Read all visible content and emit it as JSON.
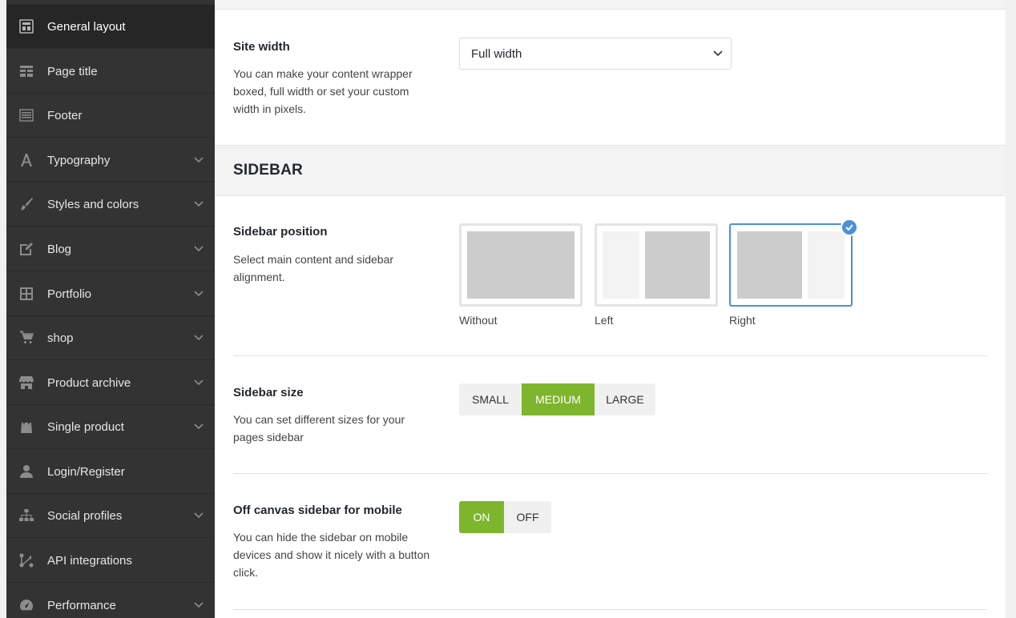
{
  "sidebar": {
    "items": [
      {
        "label": "General layout",
        "icon": "layout-icon",
        "has_chevron": false,
        "active": true
      },
      {
        "label": "Page title",
        "icon": "page-title-icon",
        "has_chevron": false,
        "active": false
      },
      {
        "label": "Footer",
        "icon": "footer-icon",
        "has_chevron": false,
        "active": false
      },
      {
        "label": "Typography",
        "icon": "typography-icon",
        "has_chevron": true,
        "active": false
      },
      {
        "label": "Styles and colors",
        "icon": "brush-icon",
        "has_chevron": true,
        "active": false
      },
      {
        "label": "Blog",
        "icon": "edit-icon",
        "has_chevron": true,
        "active": false
      },
      {
        "label": "Portfolio",
        "icon": "grid-icon",
        "has_chevron": true,
        "active": false
      },
      {
        "label": "shop",
        "icon": "cart-icon",
        "has_chevron": true,
        "active": false
      },
      {
        "label": "Product archive",
        "icon": "store-icon",
        "has_chevron": true,
        "active": false
      },
      {
        "label": "Single product",
        "icon": "bag-icon",
        "has_chevron": true,
        "active": false
      },
      {
        "label": "Login/Register",
        "icon": "user-icon",
        "has_chevron": false,
        "active": false
      },
      {
        "label": "Social profiles",
        "icon": "sitemap-icon",
        "has_chevron": true,
        "active": false
      },
      {
        "label": "API integrations",
        "icon": "integration-icon",
        "has_chevron": false,
        "active": false
      },
      {
        "label": "Performance",
        "icon": "gauge-icon",
        "has_chevron": true,
        "active": false
      }
    ]
  },
  "site_width": {
    "title": "Site width",
    "description": "You can make your content wrapper boxed, full width or set your custom width in pixels.",
    "selected": "Full width"
  },
  "section": {
    "title": "SIDEBAR"
  },
  "sidebar_position": {
    "title": "Sidebar position",
    "description": "Select main content and sidebar alignment.",
    "options": [
      "Without",
      "Left",
      "Right"
    ],
    "selected": "Right"
  },
  "sidebar_size": {
    "title": "Sidebar size",
    "description": "You can set different sizes for your pages sidebar",
    "options": [
      "SMALL",
      "MEDIUM",
      "LARGE"
    ],
    "selected": "MEDIUM"
  },
  "off_canvas": {
    "title": "Off canvas sidebar for mobile",
    "description": "You can hide the sidebar on mobile devices and show it nicely with a button click.",
    "on_label": "ON",
    "off_label": "OFF",
    "value": "ON"
  },
  "colors": {
    "accent": "#7db52c",
    "selected_border": "#4a90d9",
    "sidebar_bg": "#333333"
  }
}
